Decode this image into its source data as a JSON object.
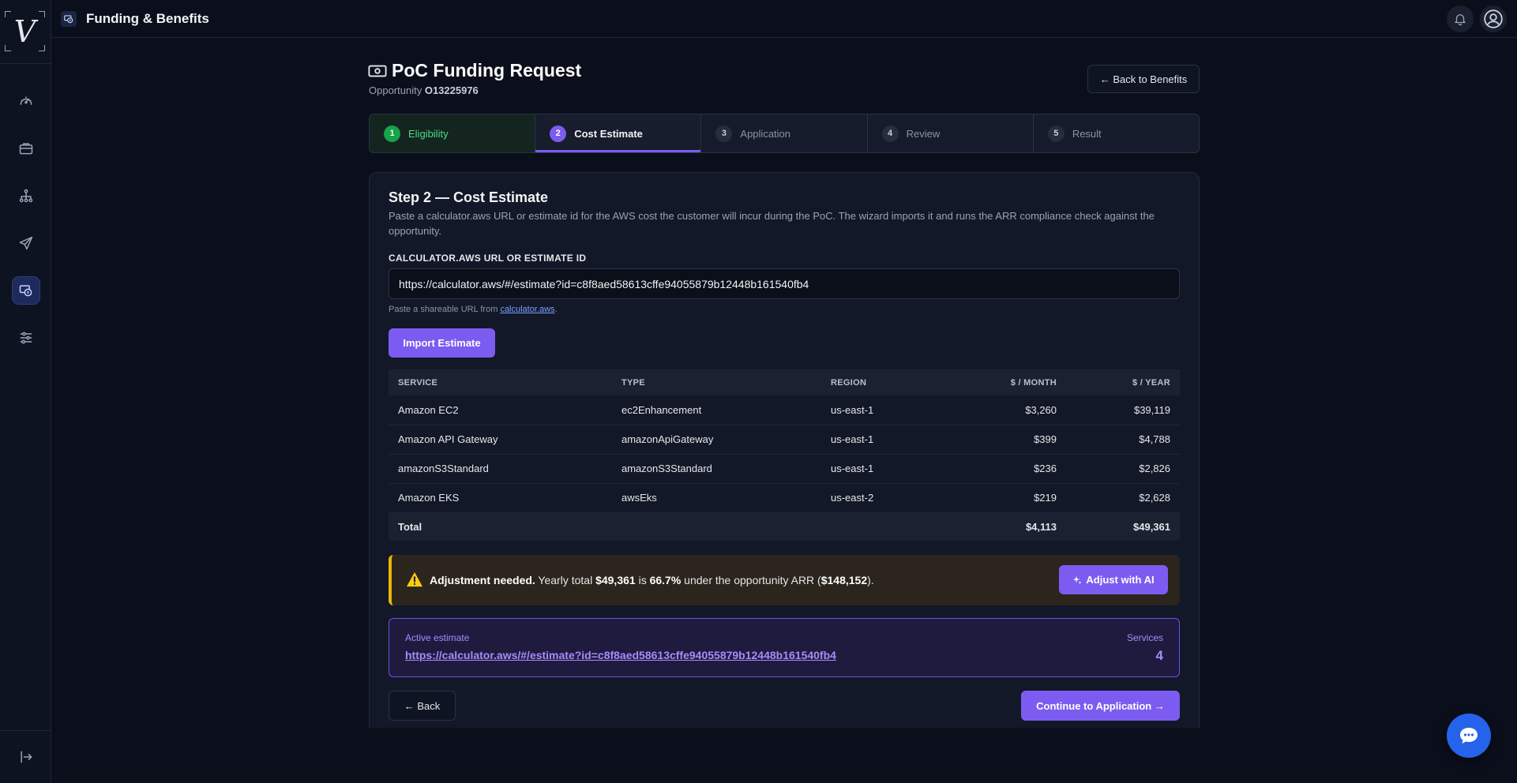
{
  "app": {
    "logo_letter": "V",
    "section_title": "Funding & Benefits"
  },
  "sidebar": {
    "items": [
      {
        "icon": "dashboard-gauge-icon"
      },
      {
        "icon": "briefcase-icon"
      },
      {
        "icon": "org-chart-icon"
      },
      {
        "icon": "send-icon"
      },
      {
        "icon": "funding-icon",
        "active": true
      },
      {
        "icon": "sliders-icon"
      }
    ],
    "collapse_icon": "collapse-sidebar-icon"
  },
  "header": {
    "title": "PoC Funding Request",
    "opportunity_label": "Opportunity",
    "opportunity_id": "O13225976",
    "back_label": "← Back to Benefits"
  },
  "stepper": {
    "steps": [
      {
        "num": "1",
        "label": "Eligibility",
        "state": "done"
      },
      {
        "num": "2",
        "label": "Cost Estimate",
        "state": "active"
      },
      {
        "num": "3",
        "label": "Application",
        "state": "pending"
      },
      {
        "num": "4",
        "label": "Review",
        "state": "pending"
      },
      {
        "num": "5",
        "label": "Result",
        "state": "pending"
      }
    ]
  },
  "card": {
    "title": "Step 2 — Cost Estimate",
    "description": "Paste a calculator.aws URL or estimate id for the AWS cost the customer will incur during the PoC. The wizard imports it and runs the ARR compliance check against the opportunity.",
    "field_label": "CALCULATOR.AWS URL OR ESTIMATE ID",
    "field_value": "https://calculator.aws/#/estimate?id=c8f8aed58613cffe94055879b12448b161540fb4",
    "helper_prefix": "Paste a shareable URL from ",
    "helper_link": "calculator.aws",
    "helper_suffix": ".",
    "import_label": "Import Estimate"
  },
  "table": {
    "headers": [
      "SERVICE",
      "TYPE",
      "REGION",
      "$ / MONTH",
      "$ / YEAR"
    ],
    "rows": [
      {
        "service": "Amazon EC2",
        "type": "ec2Enhancement",
        "region": "us-east-1",
        "month": "$3,260",
        "year": "$39,119"
      },
      {
        "service": "Amazon API Gateway",
        "type": "amazonApiGateway",
        "region": "us-east-1",
        "month": "$399",
        "year": "$4,788"
      },
      {
        "service": "amazonS3Standard",
        "type": "amazonS3Standard",
        "region": "us-east-1",
        "month": "$236",
        "year": "$2,826"
      },
      {
        "service": "Amazon EKS",
        "type": "awsEks",
        "region": "us-east-2",
        "month": "$219",
        "year": "$2,628"
      }
    ],
    "total": {
      "label": "Total",
      "month": "$4,113",
      "year": "$49,361"
    }
  },
  "warning": {
    "heading": "Adjustment needed.",
    "text_1": " Yearly total ",
    "yearly_total": "$49,361",
    "text_2": " is ",
    "percent": "66.7%",
    "text_3": " under the opportunity ARR (",
    "arr": "$148,152",
    "text_4": ").",
    "button_label": "Adjust with AI",
    "accent_color": "#eab308"
  },
  "active_estimate": {
    "label": "Active estimate",
    "url": "https://calculator.aws/#/estimate?id=c8f8aed58613cffe94055879b12448b161540fb4",
    "services_label": "Services",
    "services_count": "4"
  },
  "footer": {
    "back_label": "← Back",
    "continue_label": "Continue to Application →"
  },
  "colors": {
    "accent": "#7c5cf0",
    "success": "#16a34a",
    "chat_button": "#2563eb"
  }
}
